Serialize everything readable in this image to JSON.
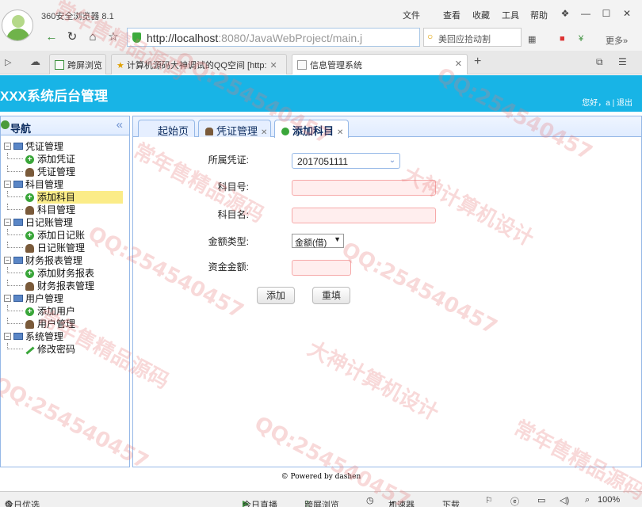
{
  "browser": {
    "title": "360安全浏览器 8.1",
    "menu": [
      "文件",
      "查看",
      "收藏",
      "工具",
      "帮助"
    ],
    "url_host": "http://localhost",
    "url_rest": ":8080/JavaWebProject/main.j",
    "search_text": "美回应拾动割",
    "more_label": "更多»",
    "tabs": [
      {
        "label": "跨屏浏览",
        "active": false
      },
      {
        "label": "计算机源码大神调试的QQ空间 [http:",
        "active": false
      },
      {
        "label": "信息管理系统",
        "active": true
      }
    ]
  },
  "header": {
    "system_title": "XXX系统后台管理",
    "greeting": "您好，a  |  退出"
  },
  "sidebar": {
    "title": "导航",
    "groups": [
      {
        "label": "凭证管理",
        "items": [
          {
            "label": "添加凭证",
            "icon": "add"
          },
          {
            "label": "凭证管理",
            "icon": "user"
          }
        ]
      },
      {
        "label": "科目管理",
        "items": [
          {
            "label": "添加科目",
            "icon": "add",
            "selected": true
          },
          {
            "label": "科目管理",
            "icon": "user"
          }
        ]
      },
      {
        "label": "日记账管理",
        "items": [
          {
            "label": "添加日记账",
            "icon": "add"
          },
          {
            "label": "日记账管理",
            "icon": "user"
          }
        ]
      },
      {
        "label": "财务报表管理",
        "items": [
          {
            "label": "添加财务报表",
            "icon": "add"
          },
          {
            "label": "财务报表管理",
            "icon": "user"
          }
        ]
      },
      {
        "label": "用户管理",
        "items": [
          {
            "label": "添加用户",
            "icon": "add"
          },
          {
            "label": "用户管理",
            "icon": "user"
          }
        ]
      },
      {
        "label": "系统管理",
        "items": [
          {
            "label": "修改密码",
            "icon": "pen"
          }
        ]
      }
    ]
  },
  "tabs": [
    {
      "label": "起始页",
      "closable": false
    },
    {
      "label": "凭证管理",
      "closable": true
    },
    {
      "label": "添加科目",
      "closable": true,
      "active": true
    }
  ],
  "form": {
    "voucher_label": "所属凭证:",
    "voucher_value": "2017051111",
    "subject_no_label": "科目号:",
    "subject_no_value": "",
    "subject_name_label": "科目名:",
    "subject_name_value": "",
    "amount_type_label": "金额类型:",
    "amount_type_value": "金额(借)",
    "amount_label": "资金金额:",
    "amount_value": "",
    "add_button": "添加",
    "reset_button": "重填"
  },
  "footer": {
    "powered": "© Powered by dashen"
  },
  "statusbar": {
    "left": "今日优选",
    "items": [
      "今日直播",
      "跨屏浏览",
      "加速器",
      "下载"
    ],
    "zoom": "100%"
  },
  "watermark": [
    "常年售精品源码",
    "QQ:254540457",
    "大神计算机设计"
  ]
}
